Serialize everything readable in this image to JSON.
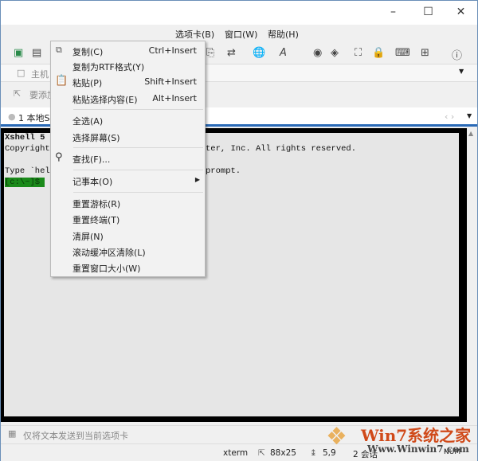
{
  "menubar": {
    "tabs": "选项卡(B)",
    "window": "窗口(W)",
    "help": "帮助(H)"
  },
  "address": {
    "label": "主机"
  },
  "links": {
    "label": "要添加"
  },
  "tab": {
    "label": "1 本地S"
  },
  "terminal": {
    "line1": "Xshell 5",
    "line2a": "Copyright",
    "line2b": "ter, Inc. All rights reserved.",
    "line3a": "Type `hel",
    "line3b": "prompt.",
    "prompt": "[c:\\~]$ "
  },
  "context_menu": {
    "items": [
      {
        "label": "复制(C)",
        "shortcut": "Ctrl+Insert"
      },
      {
        "label": "复制为RTF格式(Y)",
        "shortcut": ""
      },
      {
        "label": "粘贴(P)",
        "shortcut": "Shift+Insert"
      },
      {
        "label": "粘贴选择内容(E)",
        "shortcut": "Alt+Insert"
      },
      {
        "label": "全选(A)",
        "shortcut": ""
      },
      {
        "label": "选择屏幕(S)",
        "shortcut": ""
      },
      {
        "label": "查找(F)...",
        "shortcut": ""
      },
      {
        "label": "记事本(O)",
        "shortcut": ""
      },
      {
        "label": "重置游标(R)",
        "shortcut": ""
      },
      {
        "label": "重置终端(T)",
        "shortcut": ""
      },
      {
        "label": "清屏(N)",
        "shortcut": ""
      },
      {
        "label": "滚动缓冲区清除(L)",
        "shortcut": ""
      },
      {
        "label": "重置窗口大小(W)",
        "shortcut": ""
      }
    ]
  },
  "inputbar": {
    "text": "仅将文本发送到当前选项卡"
  },
  "status": {
    "term": "xterm",
    "size": "88x25",
    "pos": "5,9",
    "sessions": "2 会话",
    "num": "NUM"
  },
  "watermark": {
    "text": "Win7系统之家",
    "url": "Www.Winwin7.com"
  },
  "colors": {
    "prompt_bg": "#1a8a1a",
    "accent": "#2a6ab7"
  }
}
